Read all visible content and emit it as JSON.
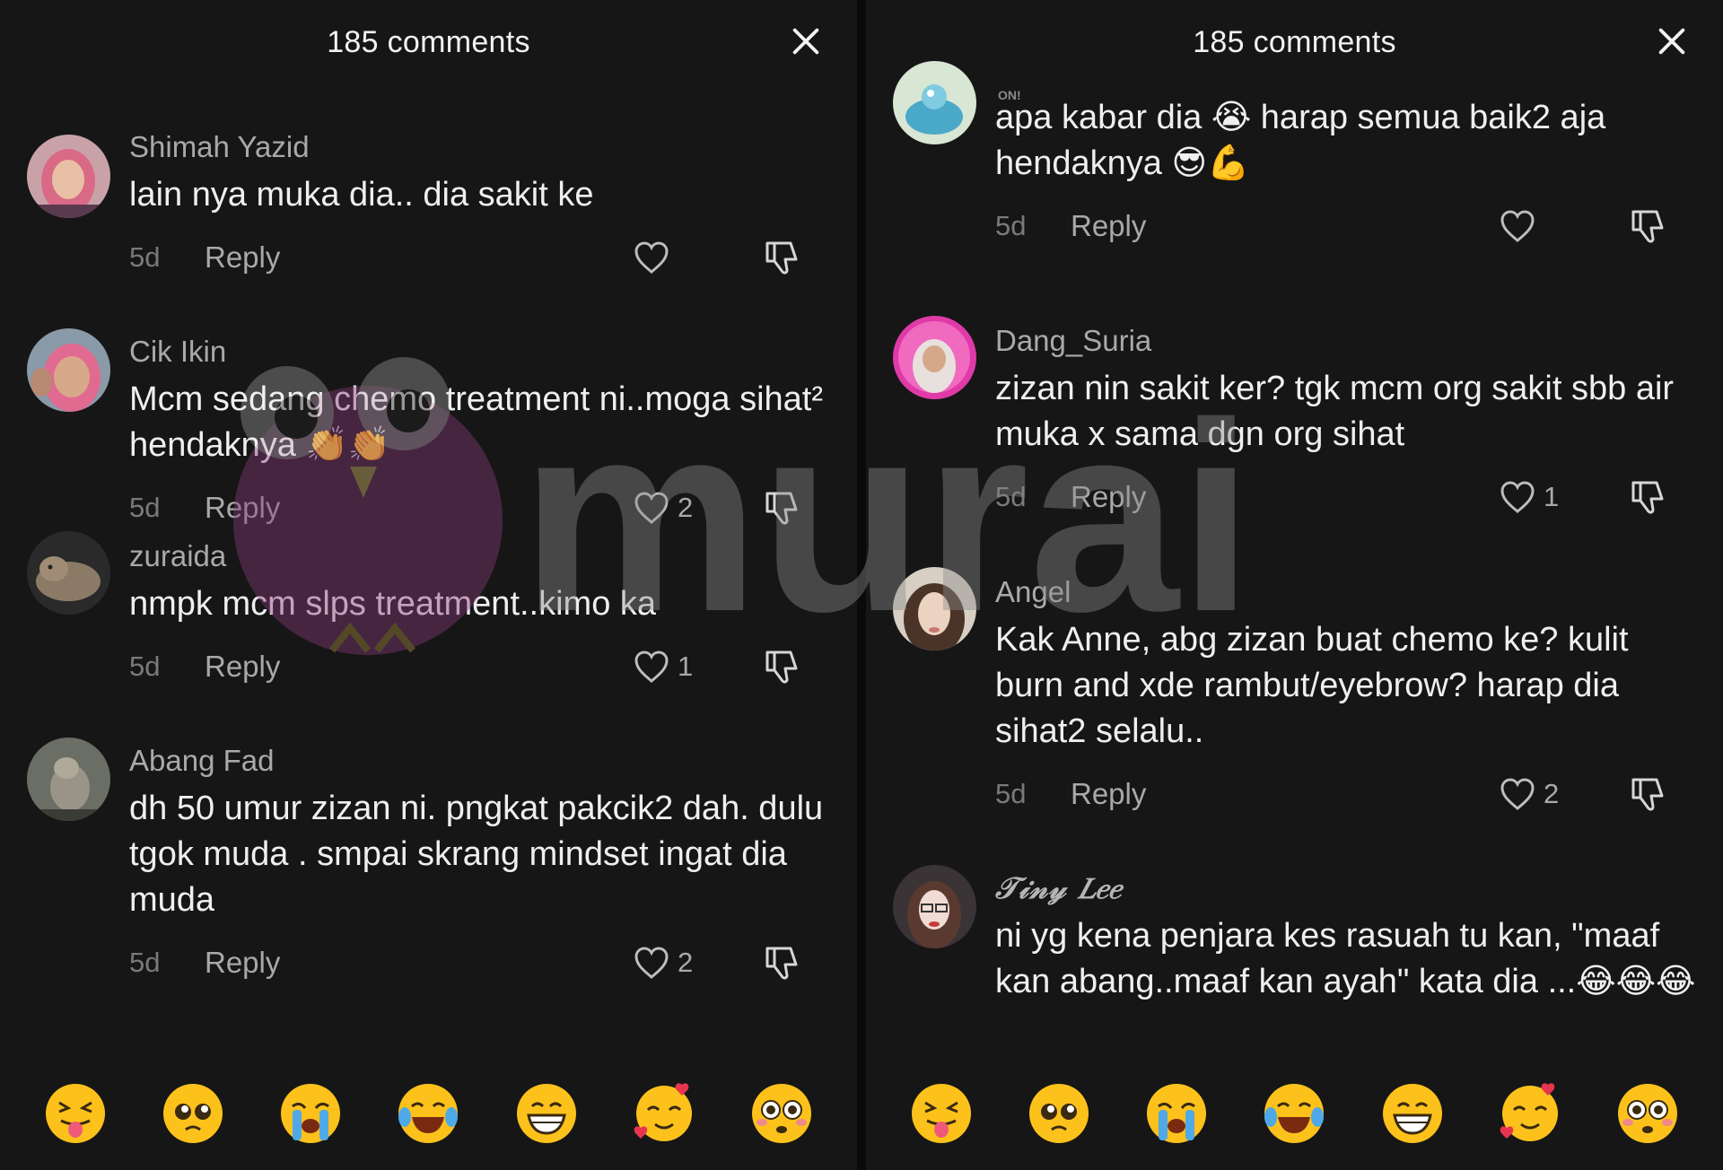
{
  "left_panel": {
    "title": "185 comments",
    "comments": [
      {
        "user": "Shimah Yazid",
        "text": "lain nya muka dia.. dia sakit ke",
        "time": "5d",
        "reply": "Reply",
        "likes": ""
      },
      {
        "user": "Cik Ikin",
        "text": "Mcm sedang chemo treatment ni..moga sihat² hendaknya 👏👏",
        "time": "5d",
        "reply": "Reply",
        "likes": "2"
      },
      {
        "user": "zuraida",
        "text": "nmpk mcm slps treatment..kimo ka",
        "time": "5d",
        "reply": "Reply",
        "likes": "1"
      },
      {
        "user": "Abang Fad",
        "text": "dh 50 umur zizan ni. pngkat pakcik2 dah. dulu tgok muda . smpai skrang mindset ingat dia muda",
        "time": "5d",
        "reply": "Reply",
        "likes": "2"
      }
    ]
  },
  "right_panel": {
    "title": "185 comments",
    "badge": "ON!",
    "comments": [
      {
        "user": "",
        "text": "apa kabar dia 😭 harap semua baik2 aja hendaknya 😎💪",
        "time": "5d",
        "reply": "Reply",
        "likes": ""
      },
      {
        "user": "Dang_Suria",
        "text": "zizan nin sakit ker? tgk mcm org sakit sbb air muka x sama dgn org sihat",
        "time": "5d",
        "reply": "Reply",
        "likes": "1"
      },
      {
        "user": "Angel",
        "text": "Kak Anne, abg zizan buat chemo ke? kulit burn and xde rambut/eyebrow? harap dia sihat2 selalu..",
        "time": "5d",
        "reply": "Reply",
        "likes": "2"
      },
      {
        "user": "𝒯𝒾𝓃𝓎 𝐿𝑒𝑒",
        "text": "ni yg kena penjara kes rasuah tu kan, \"maaf kan abang..maaf kan ayah\" kata dia ...😂😂😂",
        "time": "",
        "reply": "",
        "likes": ""
      }
    ]
  },
  "emoji_bar": [
    "squinting-tongue-emoji",
    "pleading-emoji",
    "loudly-crying-emoji",
    "tears-of-joy-emoji",
    "grinning-emoji",
    "smiling-hearts-emoji",
    "flushed-emoji"
  ],
  "watermark": {
    "text": "murai"
  },
  "colors": {
    "background": "#161616",
    "text": "#efefef",
    "muted": "#a9a9a9",
    "time": "#7a7a7a"
  }
}
